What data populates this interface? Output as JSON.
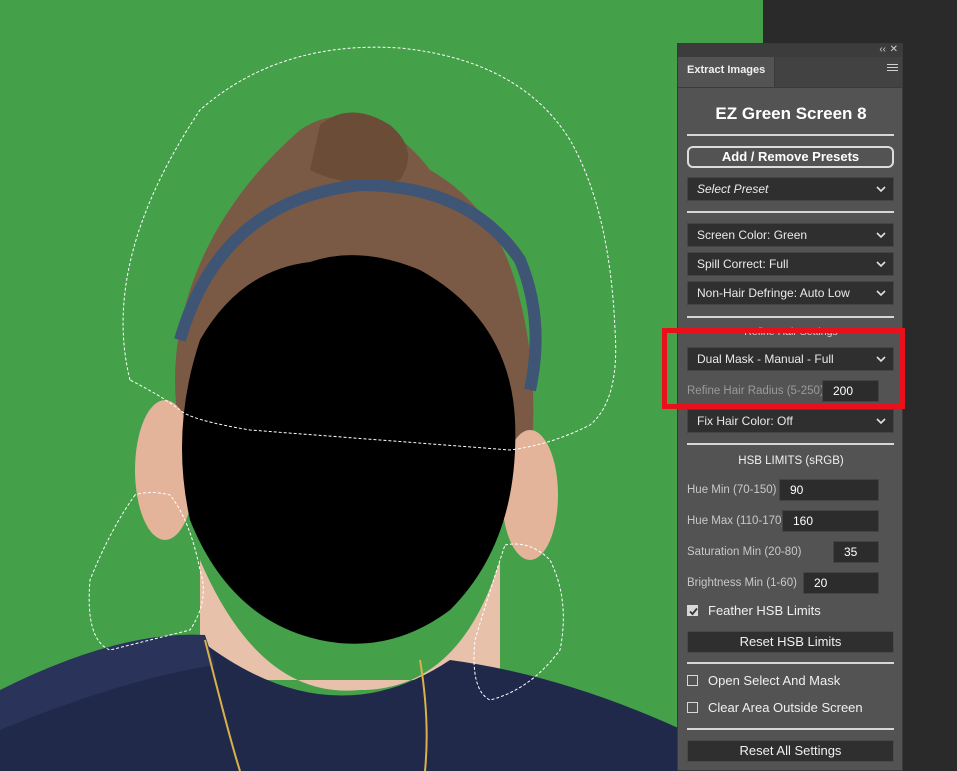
{
  "panel": {
    "tab_label": "Extract Images",
    "title": "EZ Green Screen 8",
    "add_remove_presets": "Add / Remove Presets",
    "select_preset": "Select Preset",
    "screen_color": "Screen Color: Green",
    "spill_correct": "Spill Correct: Full",
    "non_hair_defringe": "Non-Hair Defringe: Auto Low",
    "refine_hair_settings_header": "Refine Hair Settings",
    "dual_mask": "Dual Mask - Manual - Full",
    "refine_hair_radius_label": "Refine Hair Radius (5-250)",
    "refine_hair_radius_value": "200",
    "fix_hair_color": "Fix Hair Color: Off",
    "hsb_limits_header": "HSB LIMITS (sRGB)",
    "hue_min_label": "Hue Min (70-150)",
    "hue_min_value": "90",
    "hue_max_label": "Hue Max (110-170)",
    "hue_max_value": "160",
    "saturation_min_label": "Saturation Min (20-80)",
    "saturation_min_value": "35",
    "brightness_min_label": "Brightness Min (1-60)",
    "brightness_min_value": "20",
    "feather_hsb_label": "Feather HSB Limits",
    "feather_hsb_checked": true,
    "reset_hsb": "Reset HSB Limits",
    "open_select_mask_label": "Open Select And Mask",
    "open_select_mask_checked": false,
    "clear_area_label": "Clear Area Outside Screen",
    "clear_area_checked": false,
    "reset_all": "Reset All Settings",
    "collapse_glyph": "‹‹",
    "close_glyph": "✕"
  },
  "colors": {
    "green_screen": "#45a04a",
    "panel_bg": "#535353",
    "highlight": "#e8111b"
  },
  "icons": [
    "chevron-down-icon",
    "panel-menu-icon",
    "checkmark-icon",
    "collapse-icon",
    "close-icon"
  ]
}
